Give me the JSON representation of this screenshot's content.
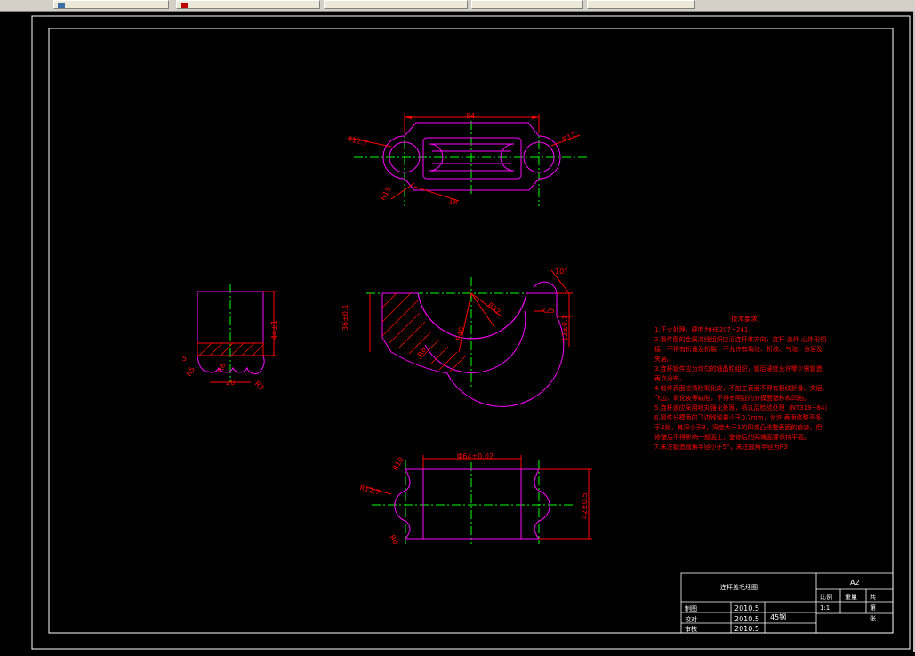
{
  "taskbar": {
    "buttons": [
      {
        "label": "",
        "icon": "window-icon"
      },
      {
        "label": "",
        "icon": "cad-icon"
      },
      {
        "label": "",
        "icon": "cad-icon"
      },
      {
        "label": "",
        "icon": "cad-icon"
      },
      {
        "label": "",
        "icon": "folder-icon"
      }
    ]
  },
  "drawing": {
    "top_view": {
      "dims": [
        "84",
        "R12.7",
        "R12",
        "R15",
        "18"
      ]
    },
    "front_view": {
      "dims": [
        "36±0.1",
        "R8",
        "R32",
        "R40",
        "R25",
        "12±0.1",
        "10°"
      ]
    },
    "side_view": {
      "dims": [
        "44±1",
        "5",
        "R5",
        "R6",
        "20",
        "R3"
      ]
    },
    "bottom_view": {
      "dims": [
        "Φ64±0.02",
        "R10",
        "R12.7",
        "R6",
        "42±0.5"
      ]
    },
    "tech_req": {
      "title": "技术要求",
      "lines": [
        "1.正火处理，硬度为HB207~241。",
        "2.锻件图的金属流线组织应沿连杆体方向，连杆    盖外    心外形相",
        "  接，不得有折叠及折裂，不允许有裂纹、折纹、气泡、分层及",
        "  夹层。",
        "3.连杆锻件应为均匀的细晶粒组织，锻后硬度允许零少需锻造",
        "  再次分布。",
        "4.锻件表面应清除氧化皮，不加工表面不得有裂纹折叠、夹层、",
        "  飞边、氧化皮等缺陷，不得有明显的分模面错移和凹陷。",
        "5.连杆盖应采用喷丸强化处理，喷丸后检验处理（NT319~84）",
        "6.锻件分模面的飞边残留量小于0.7mm，允许    表面修整不多",
        "  于2处，其深小于3，深度大于1的凹或凸修整表面的痕迹，但",
        "  修整后不得影响一般面上，整修后的两端面要保持平面。",
        "7.未注锻造圆角半径小于5°，未注圆角半径为R3"
      ]
    },
    "title_block": {
      "part_name": "连杆盖毛坯图",
      "sheet": "A2",
      "scale_label": "比例",
      "scale": "1:1",
      "weight_label": "重量",
      "count_label": "共",
      "page_label": "第",
      "sheet_unit": "张",
      "rows": [
        {
          "role": "制图",
          "date": "2010.5"
        },
        {
          "role": "校对",
          "date": "2010.5"
        },
        {
          "role": "审核",
          "date": "2010.5"
        }
      ],
      "material": "45钢"
    }
  },
  "colors": {
    "background": "#000000",
    "outline": "#ff00ff",
    "dimension": "#ff0000",
    "centerline": "#00ff00",
    "hatch": "#ff0000",
    "frame": "#ffffff",
    "inner_outline": "#ffffff"
  }
}
